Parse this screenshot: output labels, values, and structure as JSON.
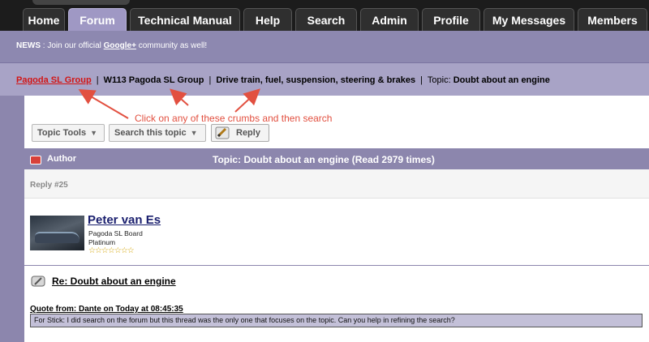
{
  "nav": {
    "tabs": [
      {
        "label": "Home"
      },
      {
        "label": "Forum",
        "active": true
      },
      {
        "label": "Technical Manual"
      },
      {
        "label": "Help"
      },
      {
        "label": "Search"
      },
      {
        "label": "Admin"
      },
      {
        "label": "Profile"
      },
      {
        "label": "My Messages"
      },
      {
        "label": "Members"
      }
    ]
  },
  "news": {
    "label": "NEWS",
    "text_before": " : Join our official ",
    "link": "Google+",
    "text_after": " community as well!"
  },
  "breadcrumbs": {
    "items": [
      {
        "label": "Pagoda SL Group"
      },
      {
        "label": "W113 Pagoda SL Group"
      },
      {
        "label": "Drive train, fuel, suspension, steering & brakes"
      }
    ],
    "separator": "|",
    "topic_prefix": "Topic:",
    "topic": "Doubt about an engine"
  },
  "annotation": {
    "text": "Click on any of these crumbs and then search",
    "color": "#e25040"
  },
  "toolbar": {
    "topic_tools": "Topic Tools",
    "search_topic": "Search this topic",
    "reply": "Reply"
  },
  "post_header": {
    "author_label": "Author",
    "topic_line": "Topic: Doubt about an engine  (Read 2979 times)"
  },
  "post": {
    "reply_num": "Reply #25",
    "username": "Peter van Es",
    "group": "Pagoda SL Board",
    "rank": "Platinum",
    "stars": "☆☆☆☆☆☆☆",
    "title": "Re: Doubt about an engine",
    "quote_header": "Quote from: Dante on Today at 08:45:35",
    "quote_text": "For Stick: I did search on the forum but this thread was the only one that focuses on the topic. Can you help in refining the search?"
  },
  "colors": {
    "nav_bg": "#1c1c1c",
    "accent": "#8c86ad",
    "crumb_active": "#d21515",
    "username": "#1a1f6e"
  }
}
